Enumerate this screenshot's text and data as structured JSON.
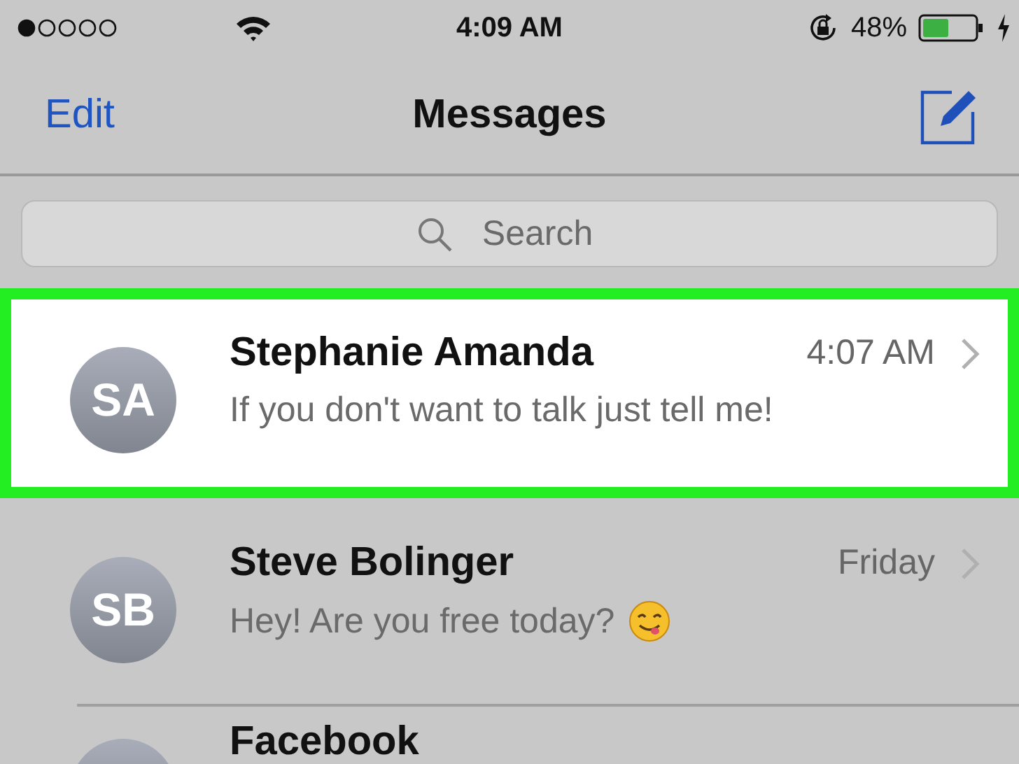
{
  "status_bar": {
    "time": "4:09 AM",
    "battery_percent": "48%"
  },
  "nav_bar": {
    "left_button": "Edit",
    "title": "Messages"
  },
  "search": {
    "placeholder": "Search"
  },
  "conversations": [
    {
      "initials": "SA",
      "name": "Stephanie Amanda",
      "time": "4:07 AM",
      "preview": "If you don't want to talk just tell me!",
      "selected": true
    },
    {
      "initials": "SB",
      "name": "Steve Bolinger",
      "time": "Friday",
      "preview": "Hey! Are you free today?",
      "emoji": true,
      "selected": false
    },
    {
      "name": "Facebook",
      "selected": false
    }
  ]
}
